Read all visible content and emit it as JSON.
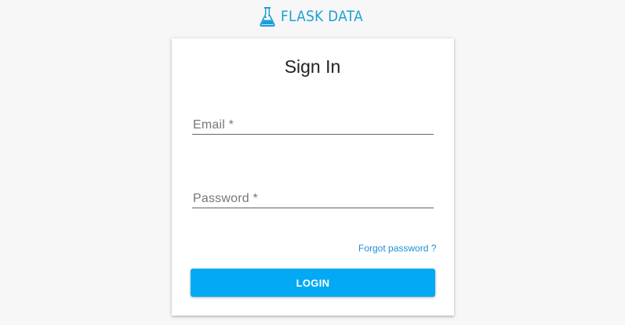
{
  "brand": {
    "name": "FLASK DATA",
    "icon": "flask-icon",
    "color": "#1c9fd6"
  },
  "form": {
    "title": "Sign In",
    "email_label": "Email *",
    "password_label": "Password *",
    "forgot_label": "Forgot password ?",
    "login_label": "LOGIN"
  },
  "colors": {
    "primary": "#03a9f4",
    "link": "#1c8fd6",
    "background": "#f7f7f7"
  }
}
